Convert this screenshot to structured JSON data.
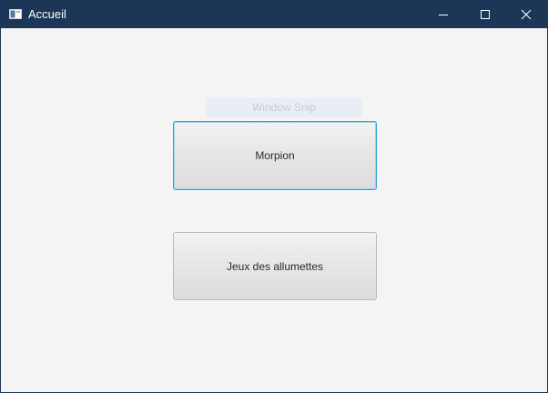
{
  "window": {
    "title": "Accueil",
    "controls": {
      "minimize": "minimize",
      "maximize": "maximize",
      "close": "close"
    }
  },
  "overlay": {
    "snip_label": "Window Snip"
  },
  "main": {
    "buttons": [
      {
        "label": "Morpion",
        "focused": true
      },
      {
        "label": "Jeux des allumettes",
        "focused": false
      }
    ]
  },
  "colors": {
    "titlebar": "#1b3656",
    "background": "#f4f4f4",
    "focus_border": "#2da2dc"
  }
}
